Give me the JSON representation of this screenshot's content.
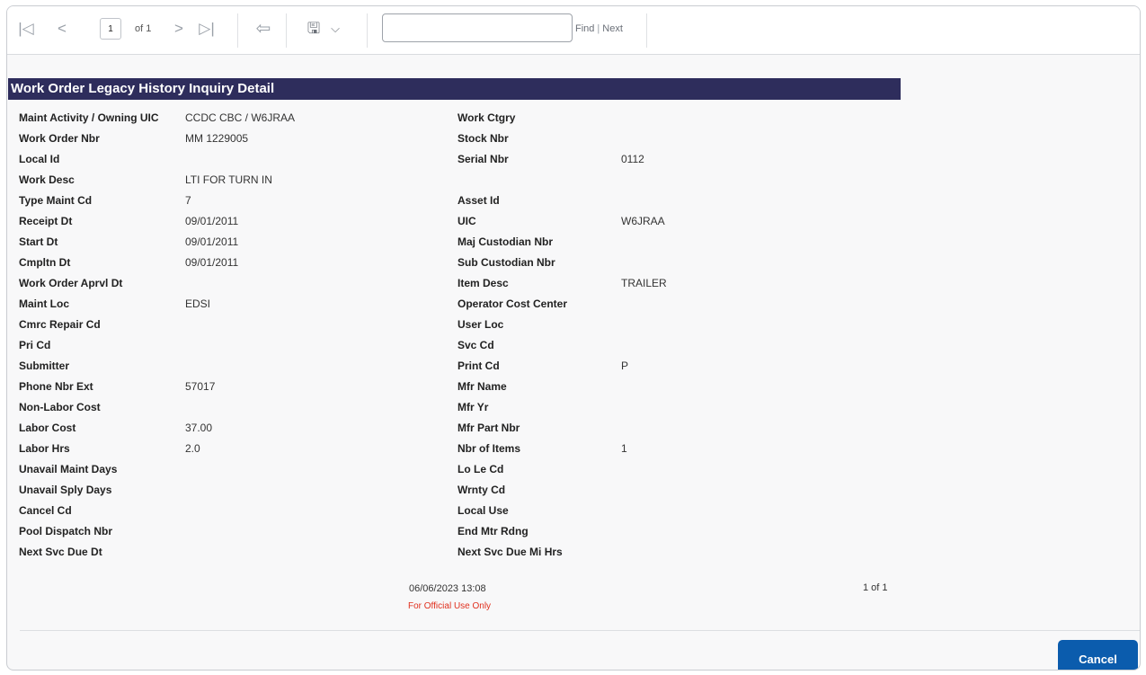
{
  "toolbar": {
    "first_page_glyph": "|◁",
    "prev_page_glyph": "<",
    "page_value": "1",
    "of_label": "of 1",
    "next_page_glyph": ">",
    "last_page_glyph": "▷|",
    "back_glyph": "⇦",
    "save_glyph": "🖫",
    "save_dropdown_glyph": "⌵",
    "find_value": "",
    "find_label": "Find",
    "find_separator": "|",
    "next_label": "Next"
  },
  "report": {
    "title": "Work Order Legacy History Inquiry Detail",
    "left_fields": [
      {
        "label": "Maint Activity / Owning UIC",
        "value": "CCDC CBC / W6JRAA"
      },
      {
        "label": "Work Order Nbr",
        "value": "MM 1229005"
      },
      {
        "label": "Local Id",
        "value": ""
      },
      {
        "label": "Work Desc",
        "value": "LTI FOR TURN IN"
      },
      {
        "label": "Type Maint Cd",
        "value": "7"
      },
      {
        "label": "Receipt Dt",
        "value": "09/01/2011"
      },
      {
        "label": "Start Dt",
        "value": "09/01/2011"
      },
      {
        "label": "Cmpltn Dt",
        "value": "09/01/2011"
      },
      {
        "label": "Work Order Aprvl Dt",
        "value": ""
      },
      {
        "label": "Maint Loc",
        "value": "EDSI"
      },
      {
        "label": "Cmrc Repair Cd",
        "value": ""
      },
      {
        "label": "Pri Cd",
        "value": ""
      },
      {
        "label": "Submitter",
        "value": ""
      },
      {
        "label": "Phone Nbr Ext",
        "value": "57017"
      },
      {
        "label": "Non-Labor Cost",
        "value": ""
      },
      {
        "label": "Labor Cost",
        "value": "37.00"
      },
      {
        "label": "Labor Hrs",
        "value": "2.0"
      },
      {
        "label": "Unavail Maint Days",
        "value": ""
      },
      {
        "label": "Unavail Sply Days",
        "value": ""
      },
      {
        "label": "Cancel Cd",
        "value": ""
      },
      {
        "label": "Pool Dispatch Nbr",
        "value": ""
      },
      {
        "label": "Next Svc Due Dt",
        "value": ""
      }
    ],
    "right_fields": [
      {
        "label": "Work Ctgry",
        "value": ""
      },
      {
        "label": "Stock Nbr",
        "value": ""
      },
      {
        "label": "Serial Nbr",
        "value": "0112"
      },
      {
        "label": "",
        "value": ""
      },
      {
        "label": "Asset Id",
        "value": ""
      },
      {
        "label": "UIC",
        "value": "W6JRAA"
      },
      {
        "label": "Maj Custodian Nbr",
        "value": ""
      },
      {
        "label": "Sub Custodian Nbr",
        "value": ""
      },
      {
        "label": "Item Desc",
        "value": "TRAILER"
      },
      {
        "label": "Operator Cost Center",
        "value": ""
      },
      {
        "label": "User Loc",
        "value": ""
      },
      {
        "label": "Svc Cd",
        "value": ""
      },
      {
        "label": "Print Cd",
        "value": "P"
      },
      {
        "label": "Mfr Name",
        "value": ""
      },
      {
        "label": "Mfr Yr",
        "value": ""
      },
      {
        "label": "Mfr Part Nbr",
        "value": ""
      },
      {
        "label": "Nbr of Items",
        "value": "1"
      },
      {
        "label": "Lo Le Cd",
        "value": ""
      },
      {
        "label": "Wrnty Cd",
        "value": ""
      },
      {
        "label": "Local Use",
        "value": ""
      },
      {
        "label": "End Mtr Rdng",
        "value": ""
      },
      {
        "label": "Next Svc Due Mi Hrs",
        "value": ""
      }
    ],
    "footer": {
      "timestamp": "06/06/2023 13:08",
      "page_indicator": "1 of 1",
      "classification": "For Official Use Only"
    }
  },
  "actions": {
    "cancel_label": "Cancel"
  },
  "colors": {
    "header_bg": "#2e2d5c",
    "cancel_bg": "#0b5cad",
    "classification_text": "#e0301e"
  }
}
